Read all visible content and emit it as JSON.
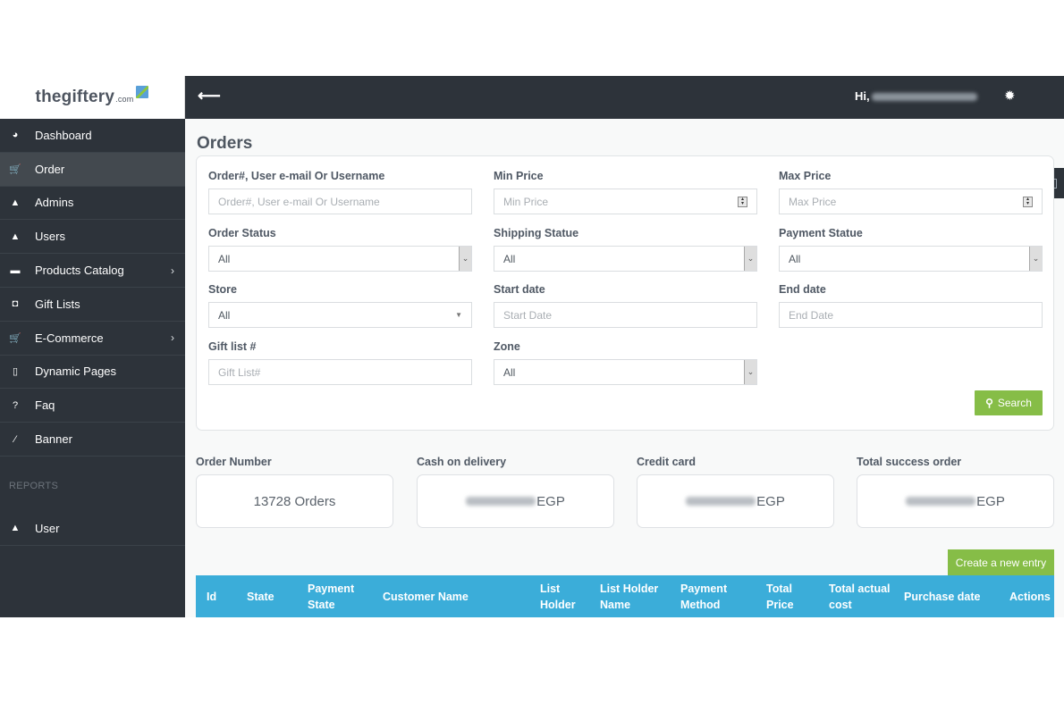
{
  "brand": {
    "name": "thegiftery",
    "suffix": ".com"
  },
  "sidebar": {
    "items": [
      {
        "label": "Dashboard",
        "icon": "dashboard-icon",
        "glyph": "◕"
      },
      {
        "label": "Order",
        "icon": "cart-icon",
        "glyph": "🛒",
        "active": true
      },
      {
        "label": "Admins",
        "icon": "user-icon",
        "glyph": "▲"
      },
      {
        "label": "Users",
        "icon": "user-icon",
        "glyph": "▲"
      },
      {
        "label": "Products Catalog",
        "icon": "briefcase-icon",
        "glyph": "▬",
        "chevron": "›"
      },
      {
        "label": "Gift Lists",
        "icon": "gift-icon",
        "glyph": "◘"
      },
      {
        "label": "E-Commerce",
        "icon": "cart-icon",
        "glyph": "🛒",
        "chevron": "›"
      },
      {
        "label": "Dynamic Pages",
        "icon": "file-icon",
        "glyph": "▯"
      },
      {
        "label": "Faq",
        "icon": "question-icon",
        "glyph": "?"
      },
      {
        "label": "Banner",
        "icon": "magic-wand-icon",
        "glyph": "⁄"
      }
    ],
    "section_label": "REPORTS",
    "report_items": [
      {
        "label": "User",
        "icon": "user-icon",
        "glyph": "▲"
      }
    ]
  },
  "topbar": {
    "back_glyph": "⟵",
    "greeting": "Hi,",
    "gear_glyph": "✹"
  },
  "page": {
    "title": "Orders"
  },
  "filters": {
    "search": {
      "label": "Order#, User e-mail Or Username",
      "placeholder": "Order#, User e-mail Or Username"
    },
    "min_price": {
      "label": "Min Price",
      "placeholder": "Min Price"
    },
    "max_price": {
      "label": "Max Price",
      "placeholder": "Max Price"
    },
    "order_status": {
      "label": "Order Status",
      "value": "All"
    },
    "shipping_status": {
      "label": "Shipping Statue",
      "value": "All"
    },
    "payment_status": {
      "label": "Payment Statue",
      "value": "All"
    },
    "store": {
      "label": "Store",
      "value": "All"
    },
    "start_date": {
      "label": "Start date",
      "placeholder": "Start Date"
    },
    "end_date": {
      "label": "End date",
      "placeholder": "End Date"
    },
    "gift_list": {
      "label": "Gift list #",
      "placeholder": "Gift List#"
    },
    "zone": {
      "label": "Zone",
      "value": "All"
    },
    "search_button": "Search"
  },
  "stats": [
    {
      "label": "Order Number",
      "value": "13728 Orders"
    },
    {
      "label": "Cash on delivery",
      "value": "EGP",
      "blurred": true
    },
    {
      "label": "Credit card",
      "value": "EGP",
      "blurred": true
    },
    {
      "label": "Total success order",
      "value": "EGP",
      "blurred": true
    }
  ],
  "create_button": "Create a new entry",
  "table": {
    "header_color": "#3badd9",
    "columns": [
      [
        "Id"
      ],
      [
        "State"
      ],
      [
        "Payment",
        "State"
      ],
      [
        "Customer Name"
      ],
      [
        "List",
        "Holder"
      ],
      [
        "List Holder",
        "Name"
      ],
      [
        "Payment",
        "Method"
      ],
      [
        "Total",
        "Price"
      ],
      [
        "Total actual",
        "cost"
      ],
      [
        "Purchase date"
      ],
      [
        "Actions"
      ]
    ]
  },
  "colors": {
    "sidebar": "#2d333a",
    "accent_green": "#86bd47",
    "table_header": "#3badd9"
  }
}
